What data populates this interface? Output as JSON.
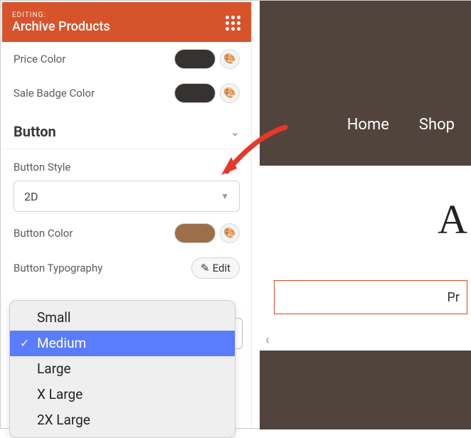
{
  "header": {
    "pre": "EDITING:",
    "title": "Archive Products"
  },
  "rows": {
    "price_color": {
      "label": "Price Color",
      "swatch": "#353230"
    },
    "sale_badge_color": {
      "label": "Sale Badge Color",
      "swatch": "#353230"
    },
    "button_color": {
      "label": "Button Color",
      "swatch": "#9d6e4a"
    },
    "button_typography": {
      "label": "Button Typography",
      "edit": "Edit"
    }
  },
  "section": {
    "title": "Button"
  },
  "button_style": {
    "label": "Button Style",
    "value": "2D"
  },
  "size_dropdown": {
    "options": [
      "Small",
      "Medium",
      "Large",
      "X Large",
      "2X Large"
    ],
    "selected_index": 1
  },
  "canvas": {
    "nav": {
      "home": "Home",
      "shop": "Shop"
    },
    "title": "A",
    "product_text": "Pr"
  }
}
